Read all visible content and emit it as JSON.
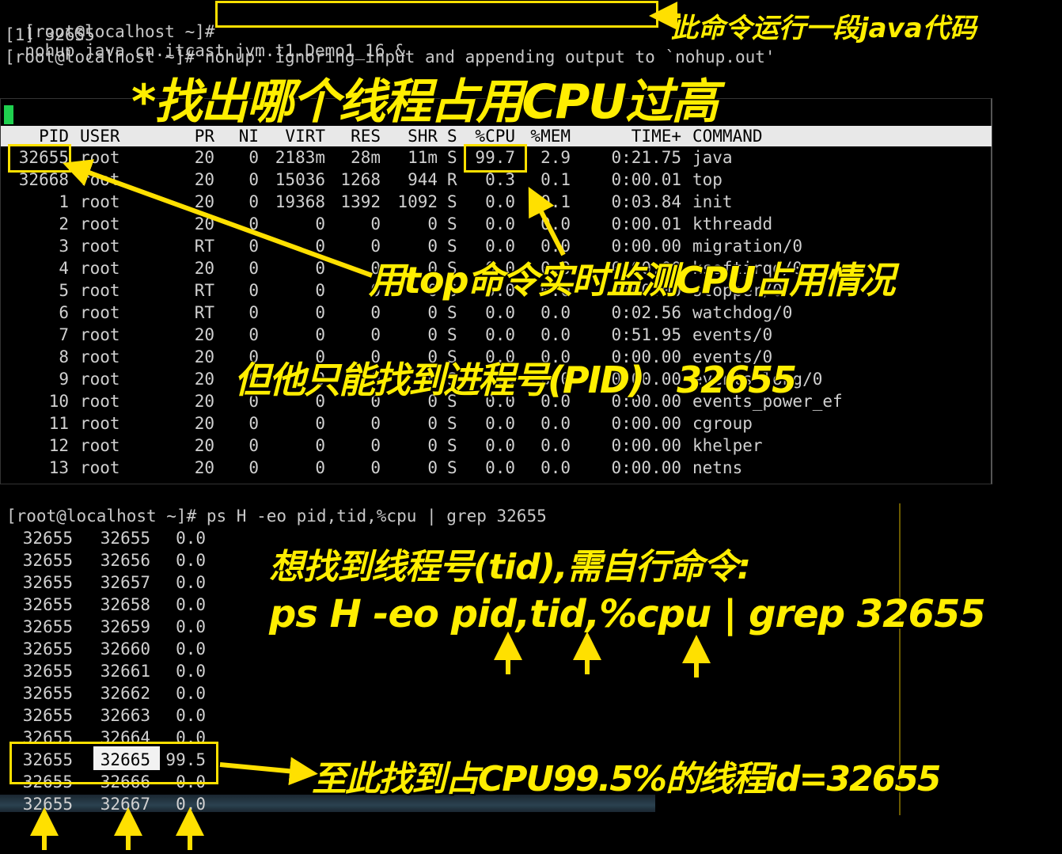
{
  "terminal_top": {
    "line1_prompt": "[root@localhost ~]#",
    "line1_cmd": "nohup java cn.itcast.jvm.t1.Demo1_16 &",
    "line2": "[1] 32655",
    "line3": "[root@localhost ~]# nohup: ignoring input and appending output to `nohup.out'"
  },
  "top_table": {
    "headers": {
      "pid": "PID",
      "user": "USER",
      "pr": "PR",
      "ni": "NI",
      "virt": "VIRT",
      "res": "RES",
      "shr": "SHR",
      "s": "S",
      "cpu": "%CPU",
      "mem": "%MEM",
      "time": "TIME+",
      "command": "COMMAND"
    },
    "rows": [
      {
        "pid": "32655",
        "user": "root",
        "pr": "20",
        "ni": "0",
        "virt": "2183m",
        "res": "28m",
        "shr": "11m",
        "s": "S",
        "cpu": "99.7",
        "mem": "2.9",
        "time": "0:21.75",
        "command": "java"
      },
      {
        "pid": "32668",
        "user": "root",
        "pr": "20",
        "ni": "0",
        "virt": "15036",
        "res": "1268",
        "shr": "944",
        "s": "R",
        "cpu": "0.3",
        "mem": "0.1",
        "time": "0:00.01",
        "command": "top"
      },
      {
        "pid": "1",
        "user": "root",
        "pr": "20",
        "ni": "0",
        "virt": "19368",
        "res": "1392",
        "shr": "1092",
        "s": "S",
        "cpu": "0.0",
        "mem": "0.1",
        "time": "0:03.84",
        "command": "init"
      },
      {
        "pid": "2",
        "user": "root",
        "pr": "20",
        "ni": "0",
        "virt": "0",
        "res": "0",
        "shr": "0",
        "s": "S",
        "cpu": "0.0",
        "mem": "0.0",
        "time": "0:00.01",
        "command": "kthreadd"
      },
      {
        "pid": "3",
        "user": "root",
        "pr": "RT",
        "ni": "0",
        "virt": "0",
        "res": "0",
        "shr": "0",
        "s": "S",
        "cpu": "0.0",
        "mem": "0.0",
        "time": "0:00.00",
        "command": "migration/0"
      },
      {
        "pid": "4",
        "user": "root",
        "pr": "20",
        "ni": "0",
        "virt": "0",
        "res": "0",
        "shr": "0",
        "s": "S",
        "cpu": "0.0",
        "mem": "0.0",
        "time": "0:00.00",
        "command": "ksoftirqd/0"
      },
      {
        "pid": "5",
        "user": "root",
        "pr": "RT",
        "ni": "0",
        "virt": "0",
        "res": "0",
        "shr": "0",
        "s": "S",
        "cpu": "0.0",
        "mem": "0.0",
        "time": "0:00.00",
        "command": "stopper/0"
      },
      {
        "pid": "6",
        "user": "root",
        "pr": "RT",
        "ni": "0",
        "virt": "0",
        "res": "0",
        "shr": "0",
        "s": "S",
        "cpu": "0.0",
        "mem": "0.0",
        "time": "0:02.56",
        "command": "watchdog/0"
      },
      {
        "pid": "7",
        "user": "root",
        "pr": "20",
        "ni": "0",
        "virt": "0",
        "res": "0",
        "shr": "0",
        "s": "S",
        "cpu": "0.0",
        "mem": "0.0",
        "time": "0:51.95",
        "command": "events/0"
      },
      {
        "pid": "8",
        "user": "root",
        "pr": "20",
        "ni": "0",
        "virt": "0",
        "res": "0",
        "shr": "0",
        "s": "S",
        "cpu": "0.0",
        "mem": "0.0",
        "time": "0:00.00",
        "command": "events/0"
      },
      {
        "pid": "9",
        "user": "root",
        "pr": "20",
        "ni": "0",
        "virt": "0",
        "res": "0",
        "shr": "0",
        "s": "S",
        "cpu": "0.0",
        "mem": "0.0",
        "time": "0:00.00",
        "command": "events_long/0"
      },
      {
        "pid": "10",
        "user": "root",
        "pr": "20",
        "ni": "0",
        "virt": "0",
        "res": "0",
        "shr": "0",
        "s": "S",
        "cpu": "0.0",
        "mem": "0.0",
        "time": "0:00.00",
        "command": "events_power_ef"
      },
      {
        "pid": "11",
        "user": "root",
        "pr": "20",
        "ni": "0",
        "virt": "0",
        "res": "0",
        "shr": "0",
        "s": "S",
        "cpu": "0.0",
        "mem": "0.0",
        "time": "0:00.00",
        "command": "cgroup"
      },
      {
        "pid": "12",
        "user": "root",
        "pr": "20",
        "ni": "0",
        "virt": "0",
        "res": "0",
        "shr": "0",
        "s": "S",
        "cpu": "0.0",
        "mem": "0.0",
        "time": "0:00.00",
        "command": "khelper"
      },
      {
        "pid": "13",
        "user": "root",
        "pr": "20",
        "ni": "0",
        "virt": "0",
        "res": "0",
        "shr": "0",
        "s": "S",
        "cpu": "0.0",
        "mem": "0.0",
        "time": "0:00.00",
        "command": "netns"
      }
    ]
  },
  "ps": {
    "command_line": "[root@localhost ~]# ps H -eo pid,tid,%cpu | grep 32655",
    "rows": [
      {
        "pid": "32655",
        "tid": "32655",
        "cpu": "0.0"
      },
      {
        "pid": "32655",
        "tid": "32656",
        "cpu": "0.0"
      },
      {
        "pid": "32655",
        "tid": "32657",
        "cpu": "0.0"
      },
      {
        "pid": "32655",
        "tid": "32658",
        "cpu": "0.0"
      },
      {
        "pid": "32655",
        "tid": "32659",
        "cpu": "0.0"
      },
      {
        "pid": "32655",
        "tid": "32660",
        "cpu": "0.0"
      },
      {
        "pid": "32655",
        "tid": "32661",
        "cpu": "0.0"
      },
      {
        "pid": "32655",
        "tid": "32662",
        "cpu": "0.0"
      },
      {
        "pid": "32655",
        "tid": "32663",
        "cpu": "0.0"
      },
      {
        "pid": "32655",
        "tid": "32664",
        "cpu": "0.0"
      },
      {
        "pid": "32655",
        "tid": "32665",
        "cpu": "99.5"
      },
      {
        "pid": "32655",
        "tid": "32666",
        "cpu": "0.0"
      },
      {
        "pid": "32655",
        "tid": "32667",
        "cpu": "0.0"
      }
    ]
  },
  "annotations": {
    "run_java": "此命令运行一段java代码",
    "title": "*找出哪个线程占用CPU过高",
    "top_monitor": "用top命令实时监测CPU占用情况",
    "only_pid": "但他只能找到进程号(PID)   32655",
    "need_tid": "想找到线程号(tid),需自行命令:",
    "ps_cmd": "ps H -eo pid,tid,%cpu | grep 32655",
    "found": "至此找到占CPU99.5%的线程id=32655"
  },
  "colors": {
    "annotation": "#ffee00",
    "terminal_text": "#d0d0d0",
    "cursor": "#1fd14f"
  }
}
